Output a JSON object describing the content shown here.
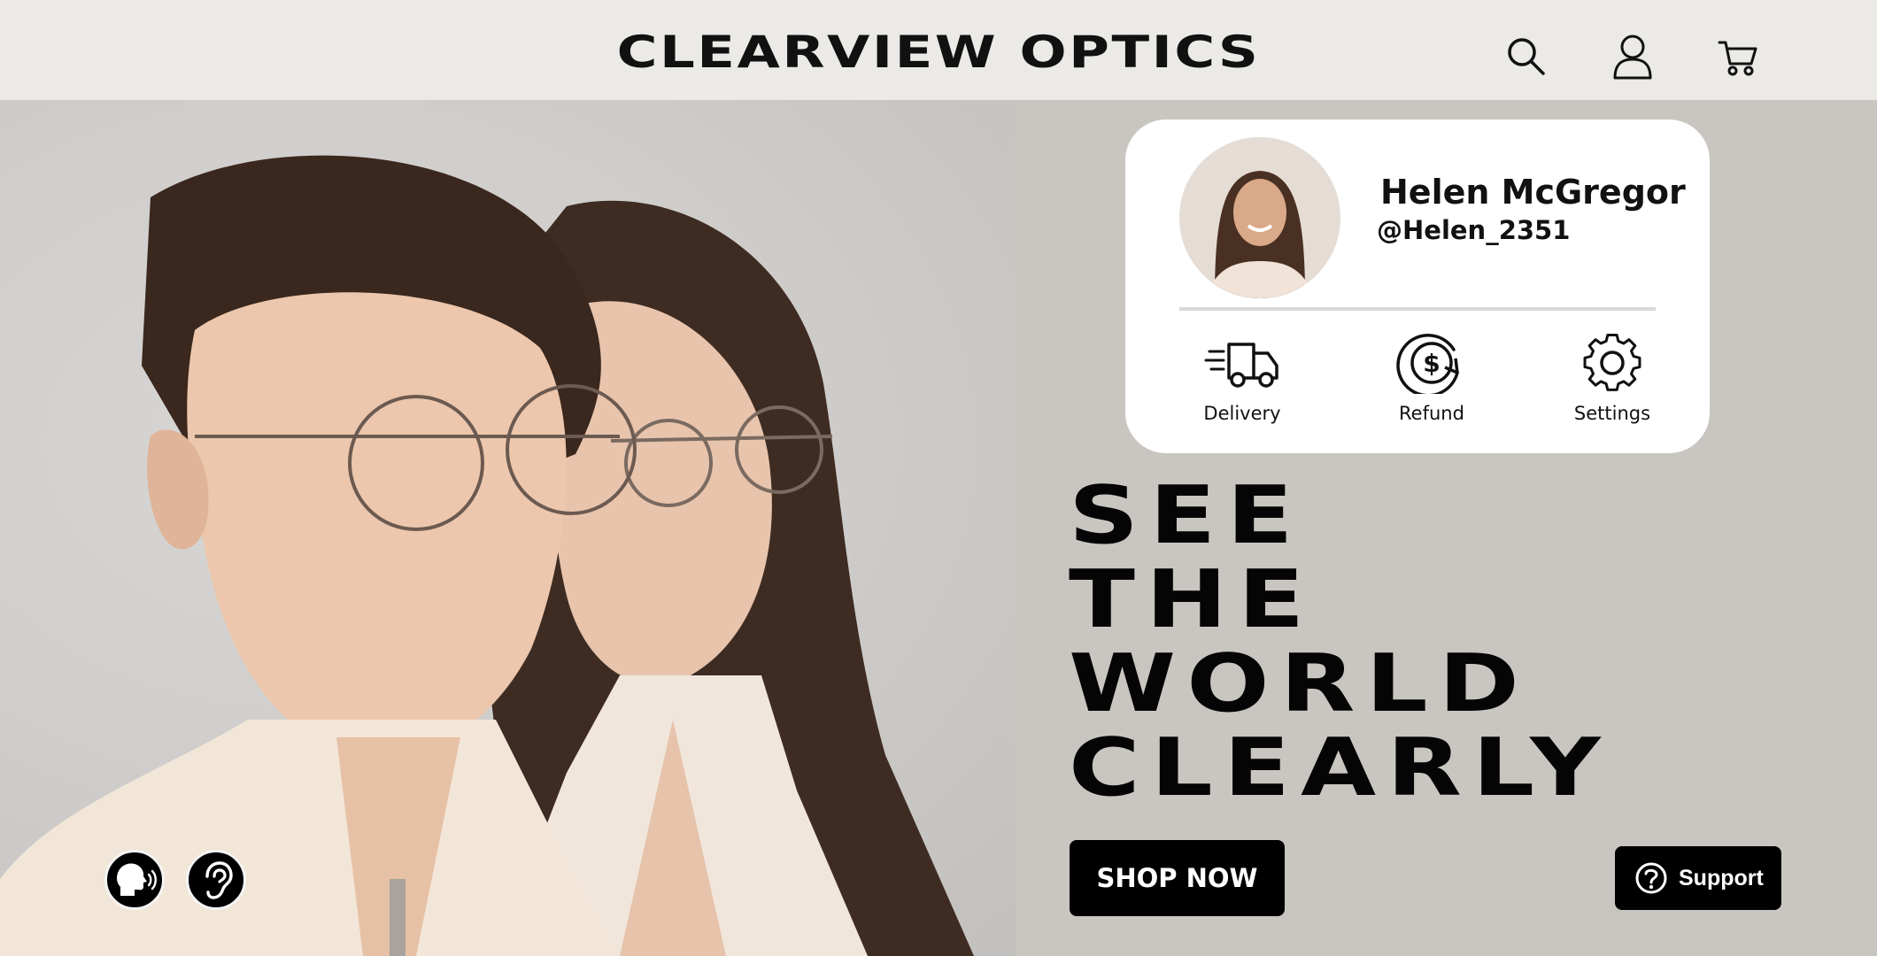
{
  "header": {
    "brand": "CLEARVIEW OPTICS",
    "icons": [
      "search-icon",
      "user-icon",
      "cart-icon"
    ]
  },
  "profile": {
    "name": "Helen McGregor",
    "handle": "@Helen_2351",
    "actions": [
      {
        "label": "Delivery",
        "icon": "delivery-truck-icon"
      },
      {
        "label": "Refund",
        "icon": "refund-dollar-icon"
      },
      {
        "label": "Settings",
        "icon": "gear-icon"
      }
    ]
  },
  "hero": {
    "headline": [
      "SEE",
      "THE",
      "WORLD",
      "CLEARLY"
    ],
    "cta_label": "SHOP NOW"
  },
  "support": {
    "label": "Support",
    "icon": "question-circle-icon"
  },
  "accessibility": {
    "icons": [
      "speech-icon",
      "hearing-icon"
    ]
  },
  "colors": {
    "header_bg": "#ebeae7",
    "panel_bg": "#c9c6c1",
    "card_bg": "#ffffff",
    "button_bg": "#000000",
    "text": "#050505"
  }
}
